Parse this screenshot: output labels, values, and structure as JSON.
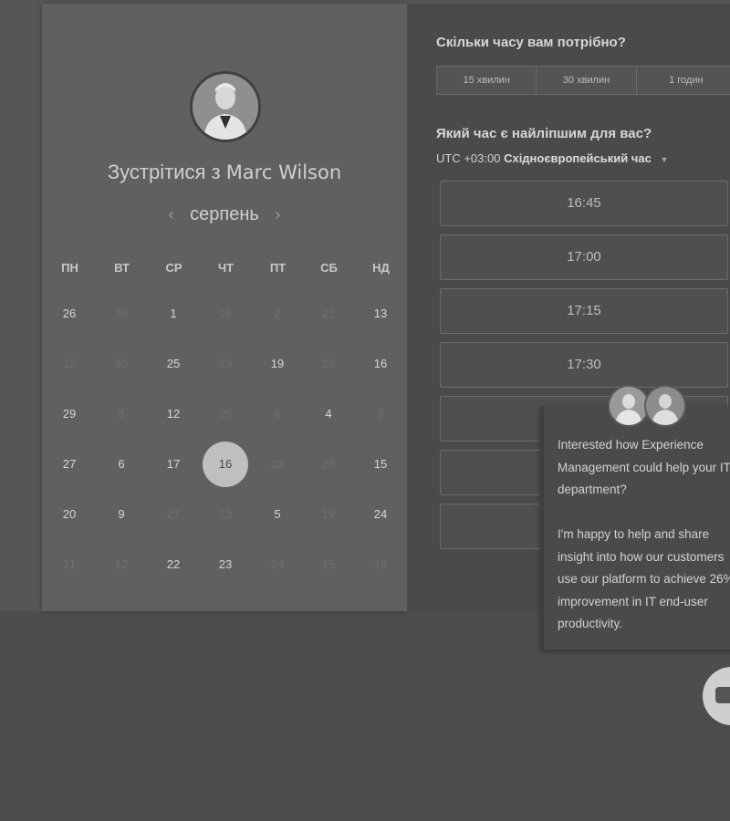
{
  "calendar": {
    "title_prefix": "Зустрітися з",
    "host_name": "Marc Wilson",
    "month": "серпень",
    "prev_icon": "chevron-left-icon",
    "next_icon": "chevron-right-icon",
    "weekdays": [
      "ПН",
      "ВТ",
      "СР",
      "ЧТ",
      "ПТ",
      "СБ",
      "НД"
    ],
    "weeks": [
      [
        {
          "d": "26",
          "a": true
        },
        {
          "d": "30",
          "a": false
        },
        {
          "d": "1",
          "a": true
        },
        {
          "d": "16",
          "a": false
        },
        {
          "d": "2",
          "a": false
        },
        {
          "d": "21",
          "a": false
        },
        {
          "d": "13",
          "a": true
        }
      ],
      [
        {
          "d": "12",
          "a": false
        },
        {
          "d": "30",
          "a": false
        },
        {
          "d": "25",
          "a": true
        },
        {
          "d": "23",
          "a": false
        },
        {
          "d": "19",
          "a": true
        },
        {
          "d": "29",
          "a": false
        },
        {
          "d": "16",
          "a": true
        }
      ],
      [
        {
          "d": "29",
          "a": true
        },
        {
          "d": "8",
          "a": false
        },
        {
          "d": "12",
          "a": true
        },
        {
          "d": "25",
          "a": false
        },
        {
          "d": "8",
          "a": false
        },
        {
          "d": "4",
          "a": true
        },
        {
          "d": "3",
          "a": false
        }
      ],
      [
        {
          "d": "27",
          "a": true
        },
        {
          "d": "6",
          "a": true
        },
        {
          "d": "17",
          "a": true
        },
        {
          "d": "16",
          "a": true,
          "selected": true
        },
        {
          "d": "23",
          "a": false
        },
        {
          "d": "25",
          "a": false
        },
        {
          "d": "15",
          "a": true
        }
      ],
      [
        {
          "d": "20",
          "a": true
        },
        {
          "d": "9",
          "a": true
        },
        {
          "d": "27",
          "a": false
        },
        {
          "d": "13",
          "a": false
        },
        {
          "d": "5",
          "a": true
        },
        {
          "d": "19",
          "a": false
        },
        {
          "d": "24",
          "a": true
        }
      ],
      [
        {
          "d": "31",
          "a": false
        },
        {
          "d": "12",
          "a": false
        },
        {
          "d": "22",
          "a": true
        },
        {
          "d": "23",
          "a": true
        },
        {
          "d": "24",
          "a": false
        },
        {
          "d": "15",
          "a": false
        },
        {
          "d": "18",
          "a": false
        }
      ]
    ]
  },
  "scheduler": {
    "duration_heading": "Скільки часу вам потрібно?",
    "durations": [
      "15 хвилин",
      "30 хвилин",
      "1 годин"
    ],
    "time_heading": "Який час є найліпшим для вас?",
    "tz_offset": "UTC +03:00",
    "tz_name": "Східноєвропейський час",
    "tz_caret_icon": "caret-down-icon",
    "slots": [
      "16:45",
      "17:00",
      "17:15",
      "17:30",
      "",
      "",
      ""
    ]
  },
  "chat": {
    "lines": [
      "Interested how Experience",
      "Management could help your IT",
      "department?",
      "",
      "I'm happy to help and share",
      "insight into how our customers",
      "use our platform to achieve 26%",
      "improvement in IT end-user",
      "productivity."
    ],
    "bubble_icon": "chat-bubble-icon"
  },
  "colors": {
    "page_bg": "#4d4d4d",
    "panel_left": "#606060",
    "panel_right": "#4a4a4a",
    "selected_day": "#bfbfbf"
  }
}
